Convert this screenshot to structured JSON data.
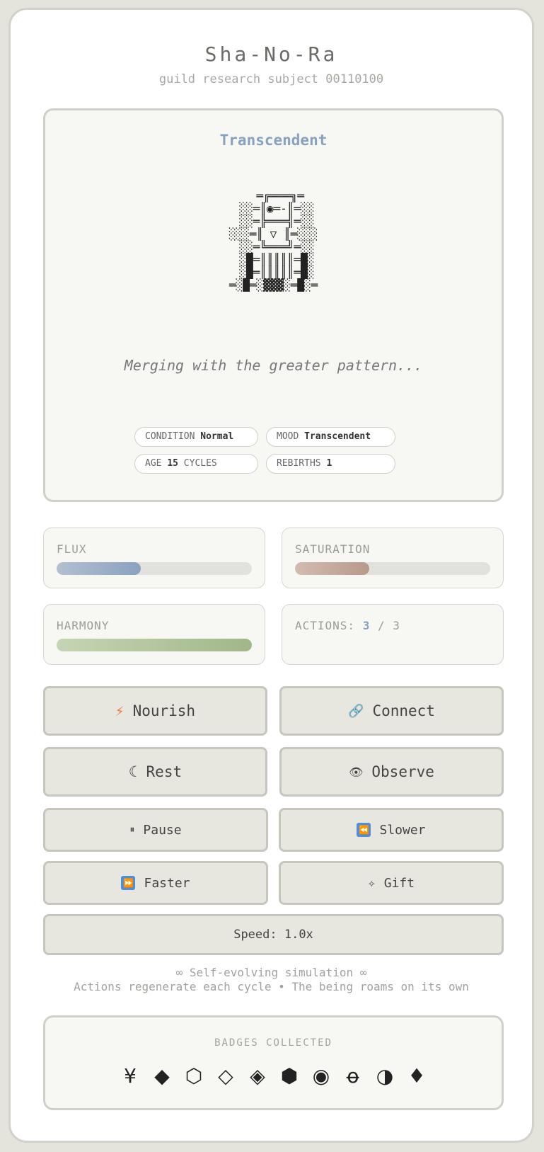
{
  "header": {
    "title": "Sha-No-Ra",
    "subtitle": "guild research subject 00110100"
  },
  "stage": {
    "mood_title": "Transcendent",
    "ascii_art": "  ═╔═══╗═\n ░░═║◉═-║═░░\n ░░═╠═══╣═░░\n░░░═║ ▽ ║═░░░\n ░░═╚═══╝═░░\n ░█═║║║║║═█░\n ░█═║║║║║═█░\n═░█═░▓▓▓░═█░═",
    "message": "Merging with the greater pattern...",
    "pills": {
      "condition_label": "CONDITION",
      "condition_value": "Normal",
      "mood_label": "MOOD",
      "mood_value": "Transcendent",
      "age_label": "AGE",
      "age_value": "15",
      "age_unit": "CYCLES",
      "rebirths_label": "REBIRTHS",
      "rebirths_value": "1"
    }
  },
  "stats": {
    "flux": {
      "label": "FLUX",
      "level": 0.43,
      "color_start": "#b2c0d0",
      "color_end": "#8aa2bf"
    },
    "saturation": {
      "label": "SATURATION",
      "level": 0.38,
      "color_start": "#d2bcb0",
      "color_end": "#b79a8b"
    },
    "harmony": {
      "label": "HARMONY",
      "level": 1.0,
      "color_start": "#c5d5b4",
      "color_end": "#a1b78a"
    },
    "actions": {
      "label": "ACTIONS:",
      "current": "3",
      "separator": "/",
      "max": "3"
    }
  },
  "buttons": {
    "nourish": {
      "label": "Nourish",
      "icon": "lightning-icon",
      "glyph": "⚡"
    },
    "connect": {
      "label": "Connect",
      "icon": "link-icon",
      "glyph": "🔗"
    },
    "rest": {
      "label": "Rest",
      "icon": "moon-icon",
      "glyph": "☾"
    },
    "observe": {
      "label": "Observe",
      "icon": "eye-icon",
      "glyph": "👁"
    },
    "pause": {
      "label": "Pause",
      "icon": "pause-icon",
      "glyph": "⏸"
    },
    "slower": {
      "label": "Slower",
      "icon": "rewind-icon",
      "glyph": "⏪"
    },
    "faster": {
      "label": "Faster",
      "icon": "fast-forward-icon",
      "glyph": "⏩"
    },
    "gift": {
      "label": "Gift",
      "icon": "sparkle-icon",
      "glyph": "✧"
    },
    "speed": {
      "label": "Speed: 1.0x"
    }
  },
  "footer": {
    "line1": "∞ Self-evolving simulation ∞",
    "line2": "Actions regenerate each cycle • The being roams on its own"
  },
  "badges": {
    "title": "BADGES COLLECTED",
    "items": [
      "¥",
      "◆",
      "⬡",
      "◇",
      "◈",
      "⬢",
      "◉",
      "o̶",
      "◑",
      "♦"
    ]
  }
}
